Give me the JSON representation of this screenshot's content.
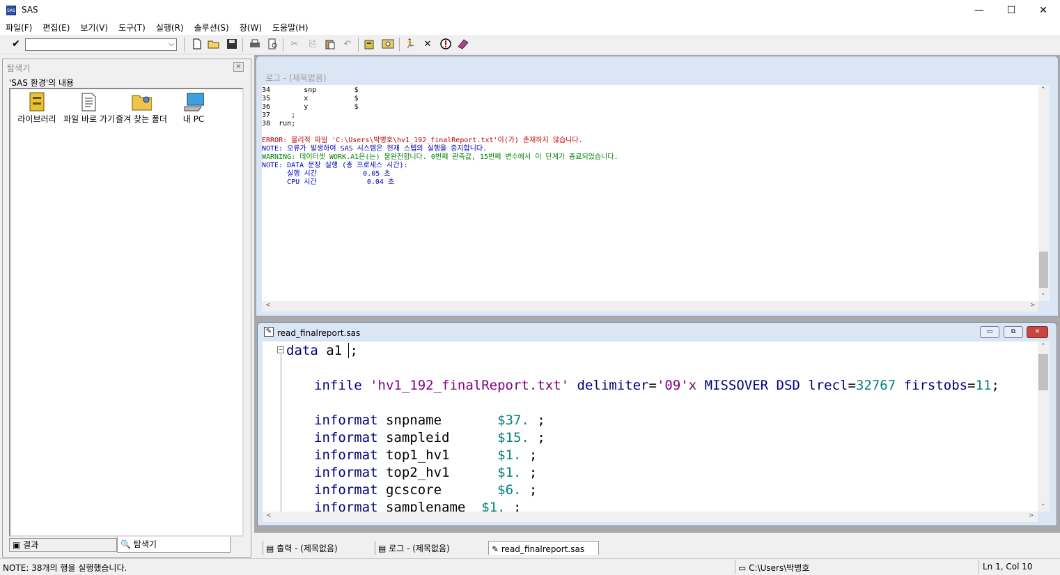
{
  "window": {
    "title": "SAS",
    "icon_text": "SAS",
    "minimize": "—",
    "maximize": "☐",
    "close": "✕"
  },
  "menu": [
    "파일(F)",
    "편집(E)",
    "보기(V)",
    "도구(T)",
    "실행(R)",
    "솔루션(S)",
    "창(W)",
    "도움말(H)"
  ],
  "toolbar": {
    "command_value": "",
    "dropdown_glyph": "⌵"
  },
  "explorer": {
    "title": "탐색기",
    "close_glyph": "×",
    "subtitle": "'SAS 환경'의 내용",
    "items": [
      {
        "label": "라이브러리",
        "icon": "library-icon"
      },
      {
        "label": "파일 바로 가기",
        "icon": "file-shortcut-icon"
      },
      {
        "label": "즐겨 찾는 폴더",
        "icon": "favorite-folder-icon"
      },
      {
        "label": "내 PC",
        "icon": "my-pc-icon"
      }
    ],
    "tabs": {
      "results": "결과",
      "explorer": "탐색기"
    }
  },
  "log": {
    "title": "로그 - (제목없음)",
    "program_lines": [
      {
        "no": "34",
        "text": "        snp         $"
      },
      {
        "no": "35",
        "text": "        x           $"
      },
      {
        "no": "36",
        "text": "        y           $"
      },
      {
        "no": "37",
        "text": "     ;"
      },
      {
        "no": "38",
        "text": "  run;"
      }
    ],
    "messages": [
      {
        "text": "ERROR: 물리적 파일 'C:\\Users\\박병호\\hv1_192_finalReport.txt'이(가) 존재하지 않습니다.",
        "color": "#c00000"
      },
      {
        "text": "NOTE: 오류가 발생하여 SAS 시스템은 현재 스텝의 실행을 중지합니다.",
        "color": "#0000c0"
      },
      {
        "text": "WARNING: 데이터셋 WORK.A1은(는) 불완전합니다. 0번째 관측값, 15번째 변수에서 이 단계가 종료되었습니다.",
        "color": "#008000"
      },
      {
        "text": "NOTE: DATA 문장 실행 (총 프로세스 시간):",
        "color": "#0000c0"
      },
      {
        "text": "      실행 시간           0.05 초",
        "color": "#0000c0"
      },
      {
        "text": "      CPU 시간            0.04 초",
        "color": "#0000c0"
      }
    ]
  },
  "editor": {
    "title": "read_finalreport.sas",
    "buttons": {
      "minimize": "▭",
      "restore": "⧉",
      "close": "✕"
    },
    "code": {
      "l1_kw": "data",
      "l1_rest": " a1 ;",
      "l2_kw": "infile",
      "l2_str1": "'hv1_192_finalReport.txt'",
      "l2_kw2": "delimiter",
      "l2_eq": "=",
      "l2_str2": "'09'x",
      "l2_kw3": "MISSOVER DSD lrecl",
      "l2_num1": "32767",
      "l2_kw4": "firstobs",
      "l2_num2": "11",
      "l2_end": ";",
      "informats": [
        {
          "kw": "informat",
          "var": "snpname   ",
          "fmt": "$37.",
          "end": " ;"
        },
        {
          "kw": "informat",
          "var": "sampleid  ",
          "fmt": "$15.",
          "end": " ;"
        },
        {
          "kw": "informat",
          "var": "top1_hv1  ",
          "fmt": "$1.",
          "end": " ;"
        },
        {
          "kw": "informat",
          "var": "top2_hv1  ",
          "fmt": "$1.",
          "end": " ;"
        },
        {
          "kw": "informat",
          "var": "gcscore   ",
          "fmt": "$6.",
          "end": " ;"
        },
        {
          "kw": "informat",
          "var": "samplename",
          "fmt": "$1.",
          "end": " ;"
        }
      ],
      "fold_glyph": "⊟"
    }
  },
  "window_tabs": [
    "출력 - (제목없음)",
    "로그 - (제목없음)",
    "read_finalreport.sas"
  ],
  "status": {
    "message": "NOTE:  38개의 행을 실행했습니다.",
    "path": "C:\\Users\\박병호",
    "position": "Ln 1, Col 10"
  },
  "colors": {
    "keyword": "#00007f",
    "string": "#800080",
    "number": "#008080",
    "error": "#c00000",
    "note": "#0000c0",
    "warning": "#008000"
  }
}
